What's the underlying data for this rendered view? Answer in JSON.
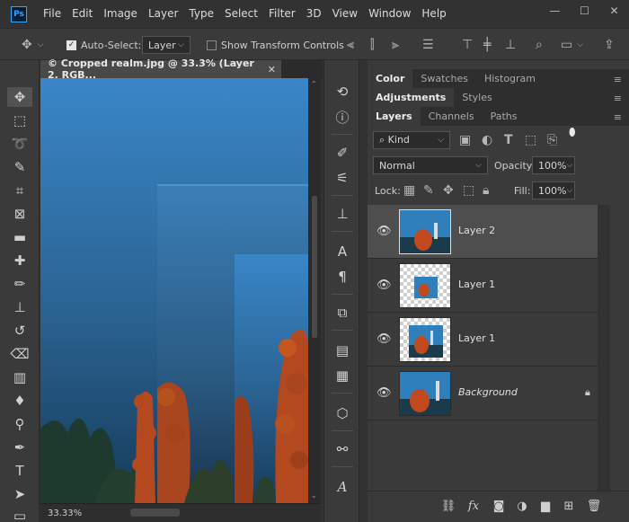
{
  "app": {
    "logo": "Ps"
  },
  "menu": [
    "File",
    "Edit",
    "Image",
    "Layer",
    "Type",
    "Select",
    "Filter",
    "3D",
    "View",
    "Window",
    "Help"
  ],
  "window_controls": {
    "minimize": "—",
    "maximize": "☐",
    "close": "✕"
  },
  "options": {
    "auto_select_label": "Auto-Select:",
    "auto_select_checked": true,
    "auto_select_target": "Layer",
    "show_transform_label": "Show Transform Controls",
    "show_transform_checked": false,
    "more": "···"
  },
  "document": {
    "tab_title": "© Cropped realm.jpg @ 33.3% (Layer 2, RGB...",
    "close": "✕",
    "zoom": "33.33%"
  },
  "panels": {
    "row1_tabs": [
      "Color",
      "Swatches",
      "Histogram"
    ],
    "row2_tabs": [
      "Adjustments",
      "Styles"
    ],
    "row3_tabs": [
      "Layers",
      "Channels",
      "Paths"
    ],
    "filter_kind": "Kind",
    "blend_mode": "Normal",
    "opacity_label": "Opacity:",
    "opacity_value": "100%",
    "lock_label": "Lock:",
    "fill_label": "Fill:",
    "fill_value": "100%",
    "menu_glyph": "≡"
  },
  "layers": [
    {
      "name": "Layer 2",
      "selected": true,
      "transparent": false,
      "locked": false
    },
    {
      "name": "Layer 1",
      "selected": false,
      "transparent": true,
      "locked": false
    },
    {
      "name": "Layer 1",
      "selected": false,
      "transparent": true,
      "locked": false
    },
    {
      "name": "Background",
      "selected": false,
      "transparent": false,
      "locked": true
    }
  ],
  "colors": {
    "accent": "#31a8ff",
    "water_top": "#3a86c8",
    "water_bottom": "#173b5a",
    "coral": "#b4481e"
  }
}
